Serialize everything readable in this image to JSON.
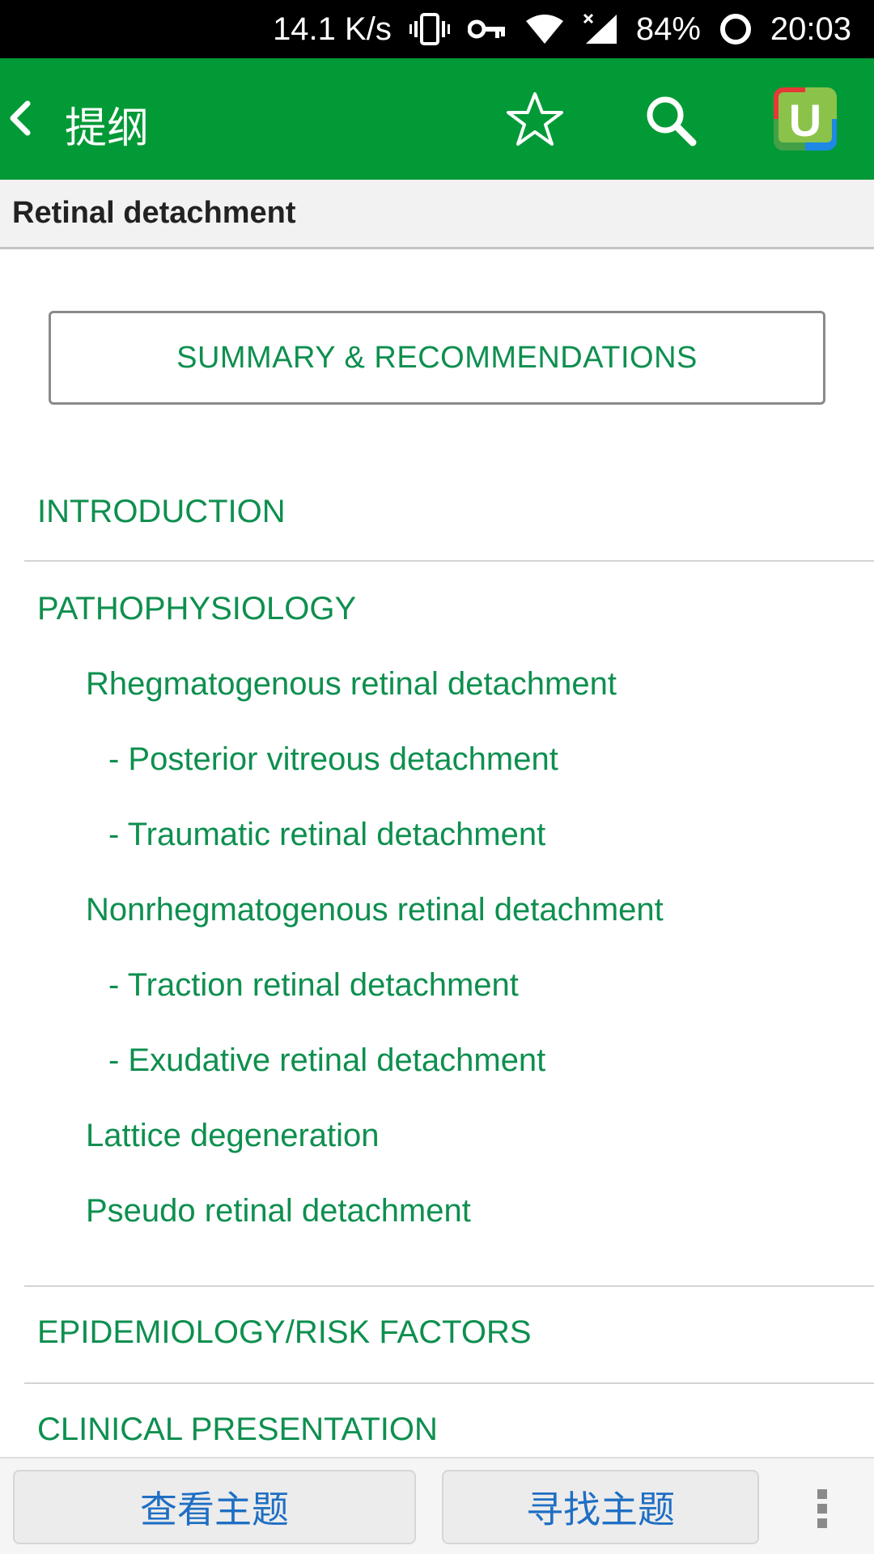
{
  "status_bar": {
    "speed": "14.1 K/s",
    "battery": "84%",
    "time": "20:03",
    "icons": [
      "vibrate-icon",
      "key-icon",
      "wifi-icon",
      "signal-icon",
      "battery-icon"
    ]
  },
  "app_bar": {
    "title": "提纲",
    "icons": [
      "back-icon",
      "star-icon",
      "search-icon",
      "app-logo"
    ],
    "logo_letter": "U"
  },
  "topic": {
    "title": "Retinal detachment"
  },
  "summary_button": {
    "label": "SUMMARY & RECOMMENDATIONS"
  },
  "outline": {
    "introduction": "INTRODUCTION",
    "pathophysiology": "PATHOPHYSIOLOGY",
    "rhegmatogenous": "Rhegmatogenous retinal detachment",
    "posterior_vitreous": "- Posterior vitreous detachment",
    "traumatic": "- Traumatic retinal detachment",
    "nonrhegmatogenous": "Nonrhegmatogenous retinal detachment",
    "traction": "- Traction retinal detachment",
    "exudative": "- Exudative retinal detachment",
    "lattice": "Lattice degeneration",
    "pseudo": "Pseudo retinal detachment",
    "epidemiology": "EPIDEMIOLOGY/RISK FACTORS",
    "clinical": "CLINICAL PRESENTATION"
  },
  "bottom_bar": {
    "view_topic": "查看主题",
    "find_topic": "寻找主题"
  },
  "colors": {
    "app_bar": "#029a36",
    "link_green": "#0e8f4f",
    "bottom_button_text": "#1f6fc3"
  }
}
